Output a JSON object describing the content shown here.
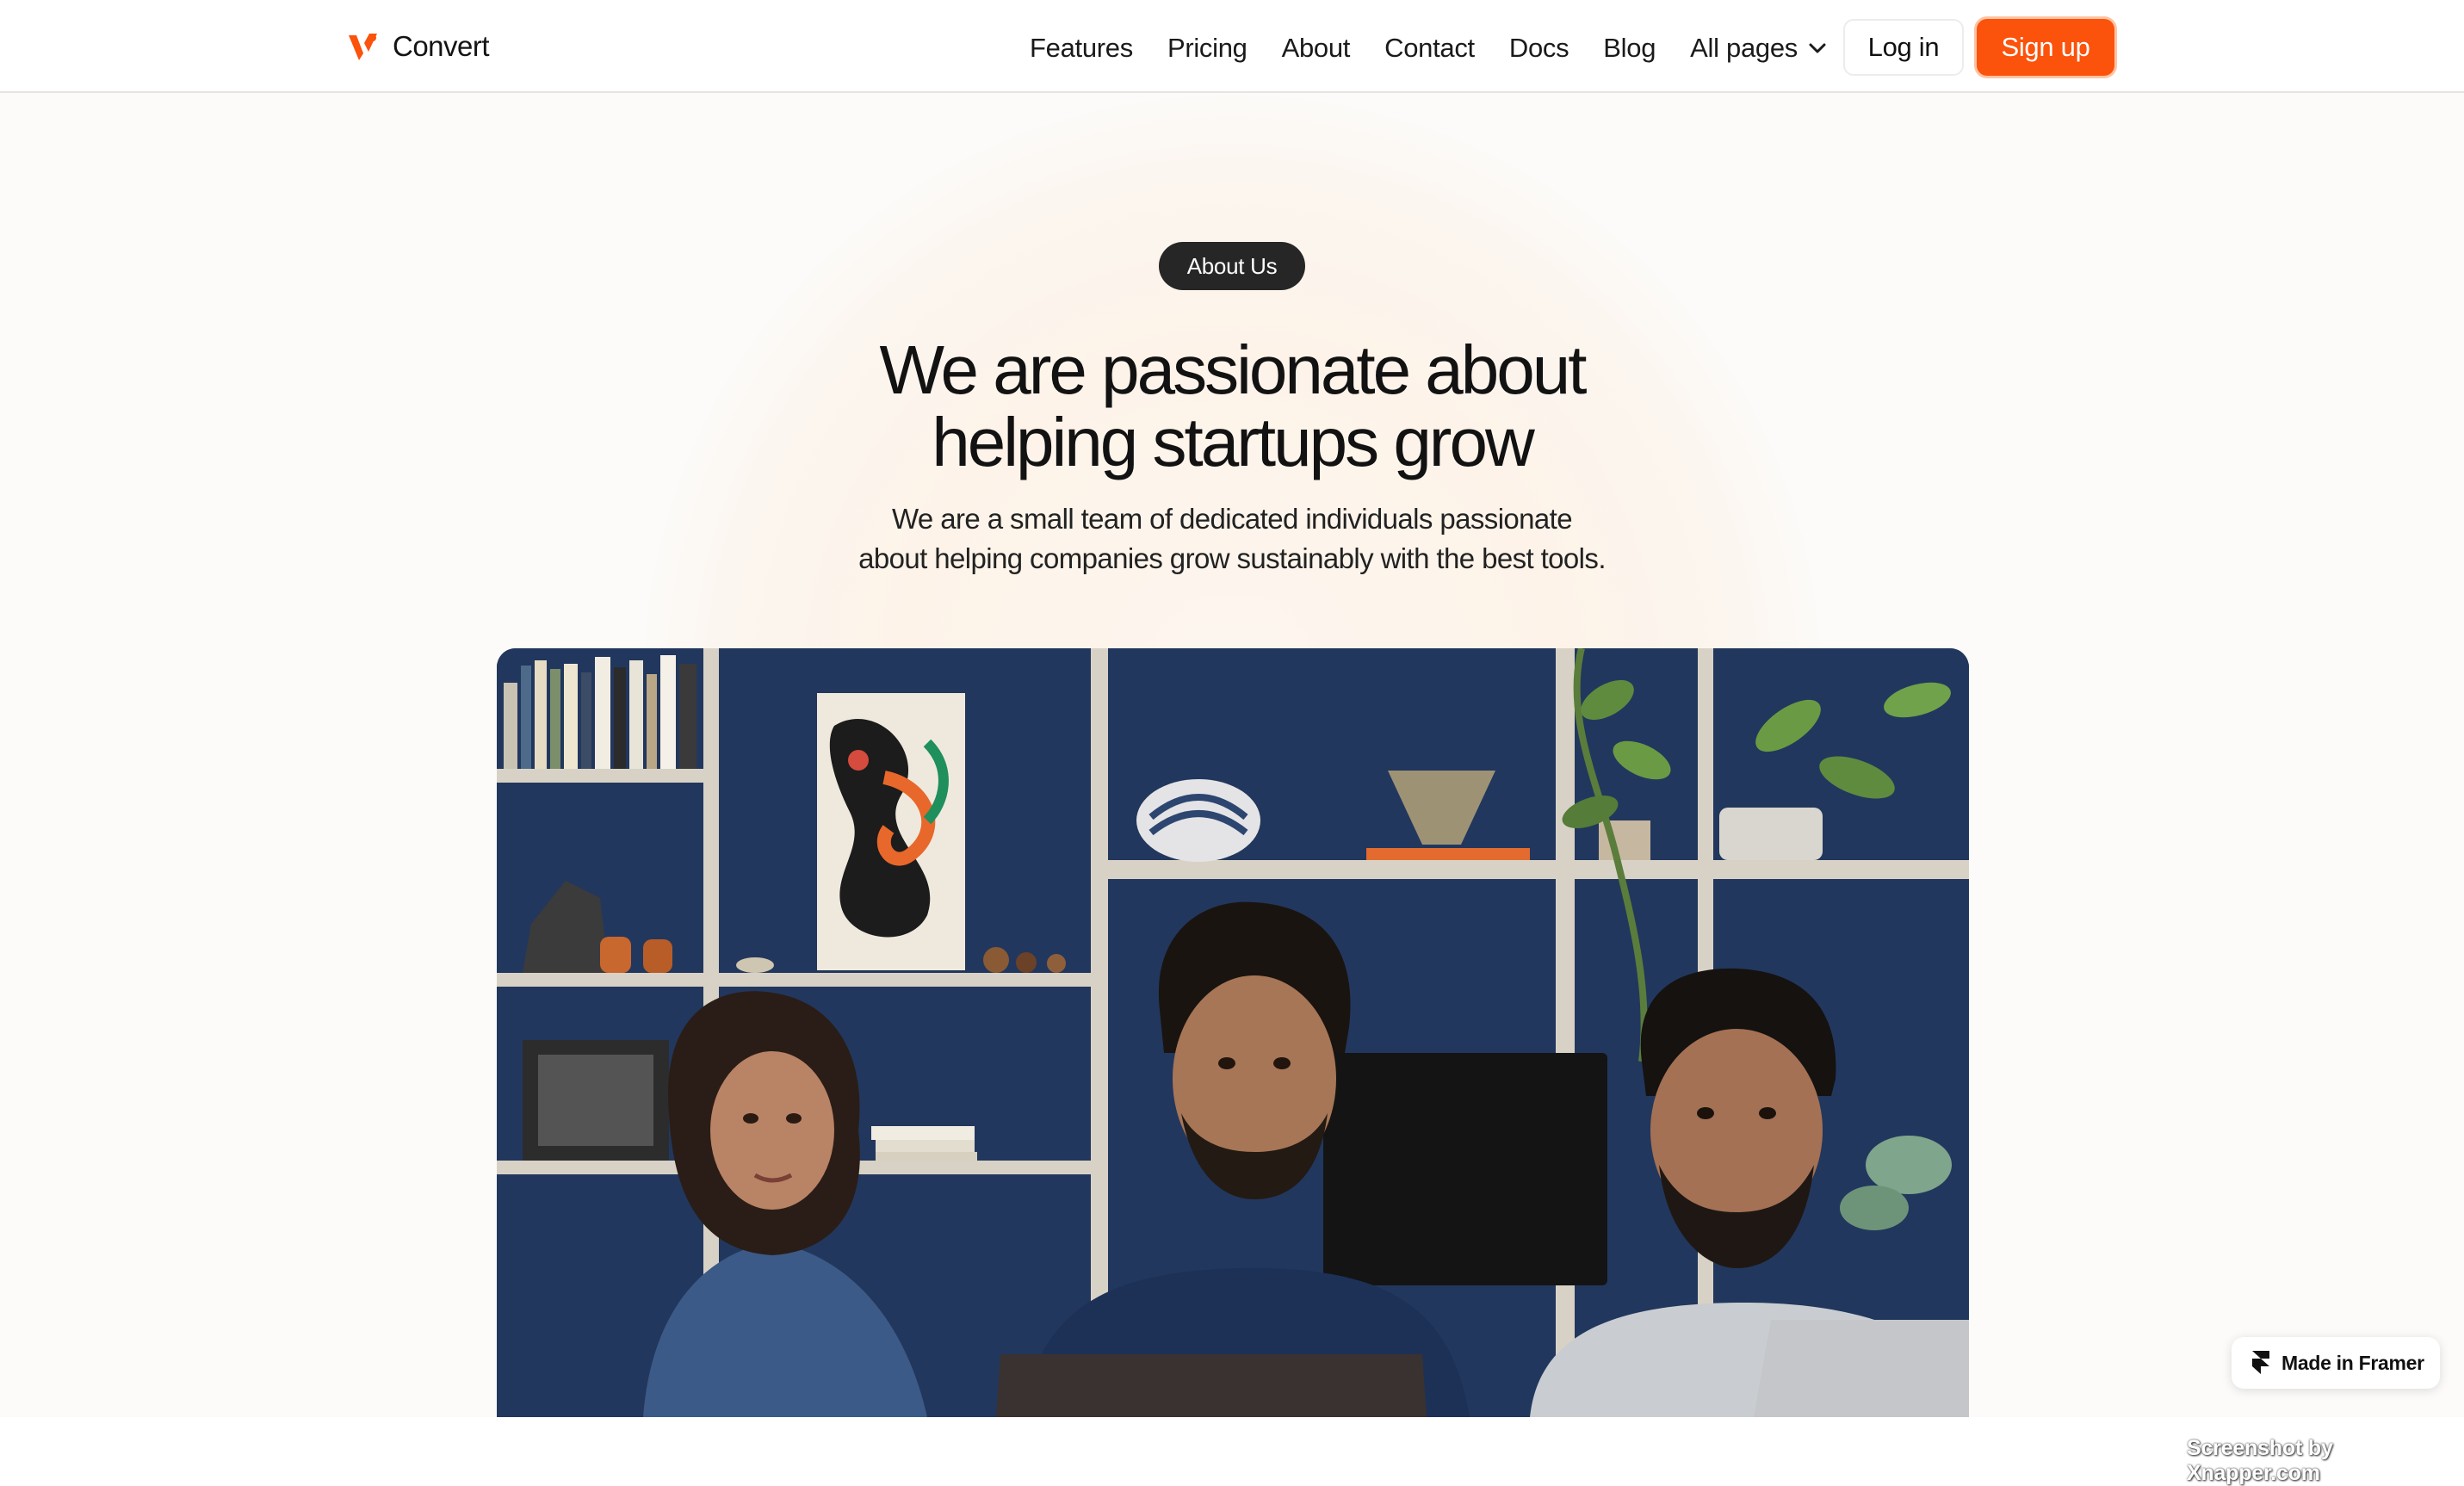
{
  "brand": {
    "name": "Convert",
    "logo_icon": "convert-logo-icon",
    "accent_color": "#fb520c"
  },
  "nav": {
    "links": [
      "Features",
      "Pricing",
      "About",
      "Contact",
      "Docs",
      "Blog"
    ],
    "all_pages_label": "All pages",
    "dropdown_icon": "chevron-down-icon",
    "login_label": "Log in",
    "signup_label": "Sign up"
  },
  "hero": {
    "badge": "About Us",
    "title_line1": "We are passionate about",
    "title_line2": "helping startups grow",
    "subtitle_line1": "We are a small team of dedicated individuals passionate",
    "subtitle_line2": "about helping companies grow sustainably with the best tools."
  },
  "framer_badge": {
    "label": "Made in Framer",
    "icon": "framer-logo-icon"
  },
  "watermark": "Screenshot by Xnapper.com"
}
